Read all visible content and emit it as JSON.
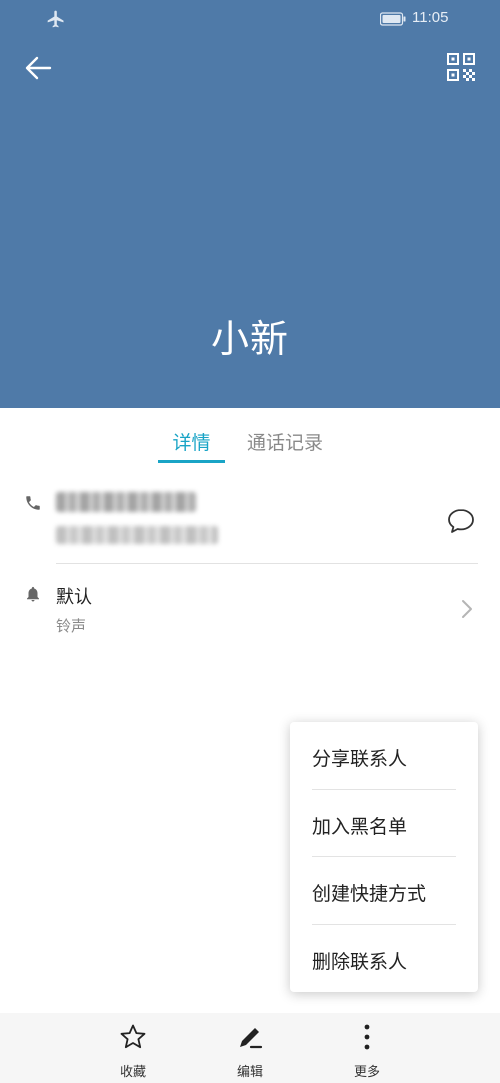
{
  "status_bar": {
    "time": "11:05",
    "icons": [
      "airplane-icon",
      "battery-icon"
    ]
  },
  "header": {
    "contact_name": "小新",
    "background_color": "#4f7aa8",
    "icons": [
      "back-arrow-icon",
      "qr-code-icon"
    ]
  },
  "tabs": [
    {
      "label": "详情",
      "active": true
    },
    {
      "label": "通话记录",
      "active": false
    }
  ],
  "accent_color": "#19a4c6",
  "details": {
    "phone_row_icons": [
      "phone-icon",
      "message-icon"
    ],
    "ringtone": {
      "title": "默认",
      "subtitle": "铃声",
      "icons": [
        "bell-icon",
        "chevron-right-icon"
      ]
    }
  },
  "popup_menu": {
    "items": [
      "分享联系人",
      "加入黑名单",
      "创建快捷方式",
      "删除联系人"
    ]
  },
  "bottom_bar": {
    "items": [
      {
        "label": "收藏",
        "icon": "star-icon"
      },
      {
        "label": "编辑",
        "icon": "edit-icon"
      },
      {
        "label": "更多",
        "icon": "more-vertical-icon"
      }
    ]
  }
}
